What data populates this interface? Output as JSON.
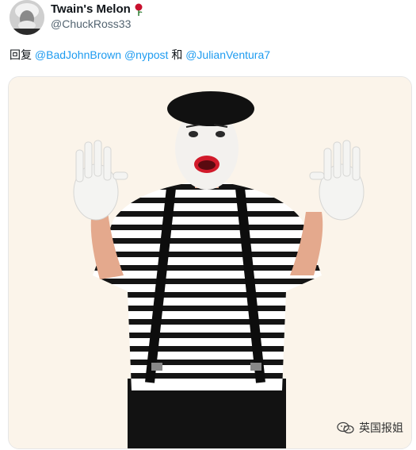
{
  "tweet": {
    "display_name": "Twain's Melon",
    "handle": "@ChuckRoss33",
    "reply_prefix": "回复",
    "mentions": [
      "@BadJohnBrown",
      "@nypost",
      "@JulianVentura7"
    ],
    "reply_joiner": "和",
    "name_emoji_icon": "rose-icon"
  },
  "media": {
    "watermark_text": "英国报姐",
    "watermark_icon": "wechat-icon"
  },
  "colors": {
    "mention": "#1d9bf0",
    "handle": "#536471",
    "image_background": "#fbf4ea"
  }
}
